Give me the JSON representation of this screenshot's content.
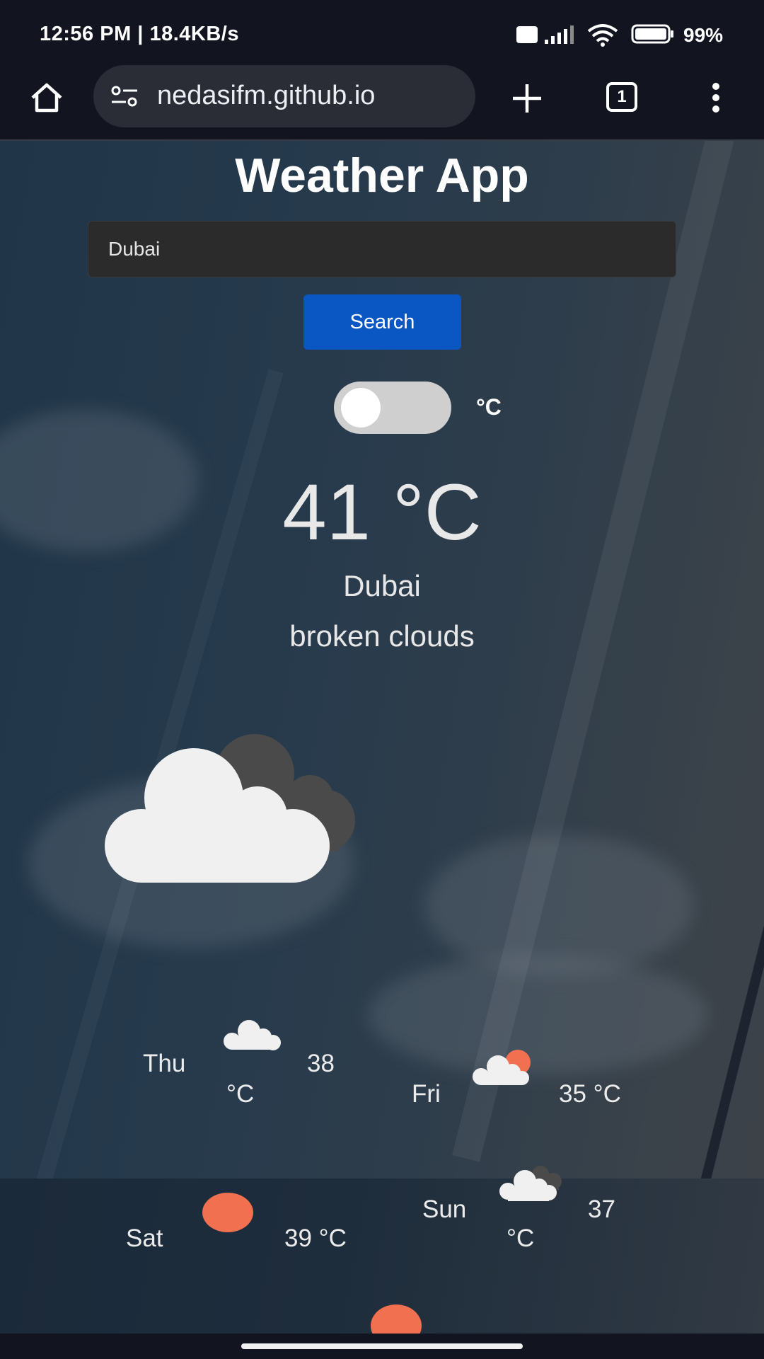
{
  "status_bar": {
    "time_speed": "12:56 PM | 18.4KB/s",
    "network_badge": "Vo LTE",
    "battery": "99%"
  },
  "browser": {
    "url": "nedasifm.github.io",
    "tab_count": "1"
  },
  "app": {
    "title": "Weather App",
    "search_value": "Dubai",
    "search_button": "Search",
    "unit_label": "°C",
    "temperature": "41 °C",
    "city": "Dubai",
    "description": "broken clouds",
    "main_icon": "broken-clouds-icon"
  },
  "forecast": [
    {
      "day": "Thu",
      "temp_value": "38",
      "temp_unit": "°C",
      "icon": "few-clouds-icon"
    },
    {
      "day": "Fri",
      "temp": "35 °C",
      "icon": "cloud-sun-icon"
    },
    {
      "day": "Sat",
      "temp": "39 °C",
      "icon": "sun-icon"
    },
    {
      "day": "Sun",
      "temp_value": "37",
      "temp_unit": "°C",
      "icon": "broken-clouds-icon"
    }
  ],
  "colors": {
    "accent_button": "#0a56c2",
    "sun": "#f07050"
  }
}
